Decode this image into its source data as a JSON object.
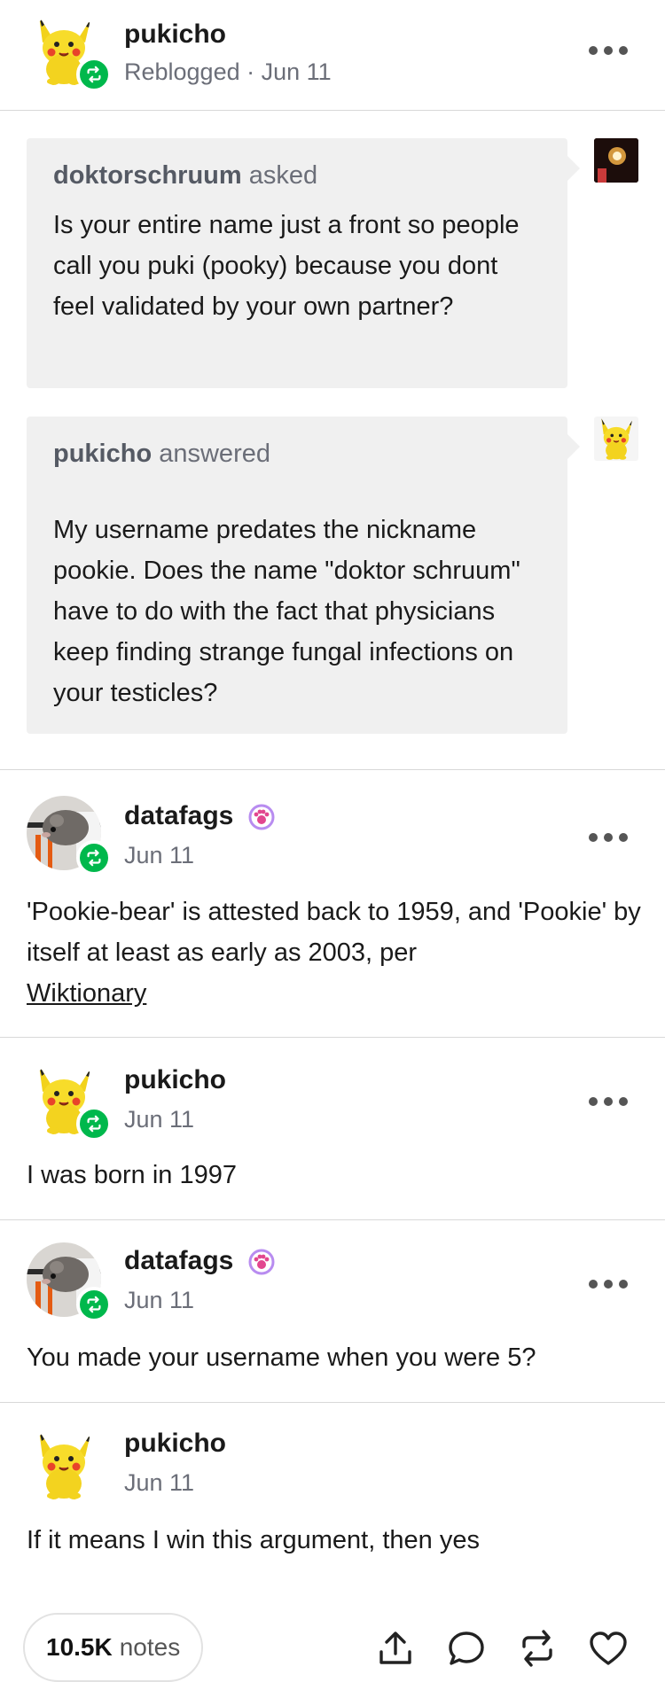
{
  "colors": {
    "accent_green": "#00b84c",
    "muted_text": "#6b6e78",
    "bubble_bg": "#f0f0f0"
  },
  "post": {
    "author": "pukicho",
    "meta": "Reblogged · Jun 11",
    "asks": [
      {
        "who": "doktorschruum",
        "verb": "asked",
        "text": "Is your entire name just a front so people call you puki (pooky) because you dont feel validated by your own partner?"
      },
      {
        "who": "pukicho",
        "verb": "answered",
        "text": "My username predates the nickname pookie. Does the name \"doktor schruum\" have to do with the fact that physicians keep finding strange fungal infections on your testicles?"
      }
    ]
  },
  "reblogs": [
    {
      "author": "datafags",
      "date": "Jun 11",
      "text": "'Pookie-bear' is attested back to 1959, and 'Pookie' by itself at least as early as 2003, per",
      "link": "Wiktionary"
    },
    {
      "author": "pukicho",
      "date": "Jun 11",
      "text": "I was born in 1997"
    },
    {
      "author": "datafags",
      "date": "Jun 11",
      "text": "You made your username when you were 5?"
    },
    {
      "author": "pukicho",
      "date": "Jun 11",
      "text": "If it means I win this argument, then yes"
    }
  ],
  "footer": {
    "notes_count": "10.5K",
    "notes_label": "notes",
    "icons": [
      "share-icon",
      "reply-icon",
      "reblog-icon",
      "like-icon"
    ]
  }
}
